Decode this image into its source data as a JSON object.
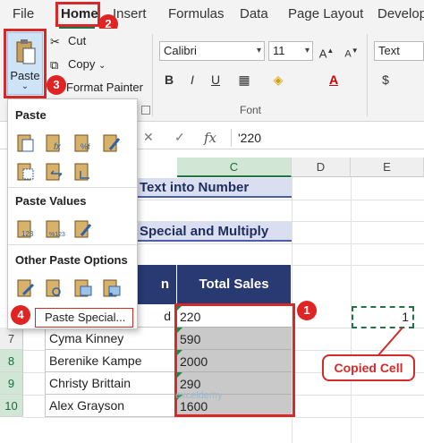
{
  "ribbon": {
    "tabs": [
      "File",
      "Home",
      "Insert",
      "Formulas",
      "Data",
      "Page Layout",
      "Develop"
    ],
    "active_tab": "Home",
    "clipboard": {
      "paste_label": "Paste",
      "cut_label": "Cut",
      "copy_label": "Copy",
      "format_painter_label": "Format Painter"
    },
    "font": {
      "name": "Calibri",
      "size": "11",
      "group_label": "Font",
      "bold": "B",
      "italic": "I",
      "underline": "U"
    },
    "number": {
      "format": "Text",
      "currency": "$"
    }
  },
  "formula_bar": {
    "fx": "fx",
    "value": "'220"
  },
  "paste_menu": {
    "section_paste": "Paste",
    "section_paste_values": "Paste Values",
    "section_other": "Other Paste Options",
    "paste_special_label": "Paste Special..."
  },
  "sheet": {
    "columns": [
      "C",
      "D",
      "E"
    ],
    "selected_column": "C",
    "rows": [
      "7",
      "8",
      "9",
      "10"
    ],
    "title1": "Text into Number",
    "title2": "Special and Multiply",
    "header_name_fragment": "n",
    "header_sales": "Total Sales",
    "names": [
      "d",
      "Cyma Kinney",
      "Berenike Kampe",
      "Christy Brittain",
      "Alex Grayson"
    ],
    "sales": [
      "220",
      "590",
      "2000",
      "290",
      "1600"
    ],
    "e6_value": "1"
  },
  "annotations": {
    "badges": [
      "1",
      "2",
      "3",
      "4"
    ],
    "callout": "Copied Cell",
    "color_accent": "#d42a2a"
  },
  "watermark": "exceldemy"
}
